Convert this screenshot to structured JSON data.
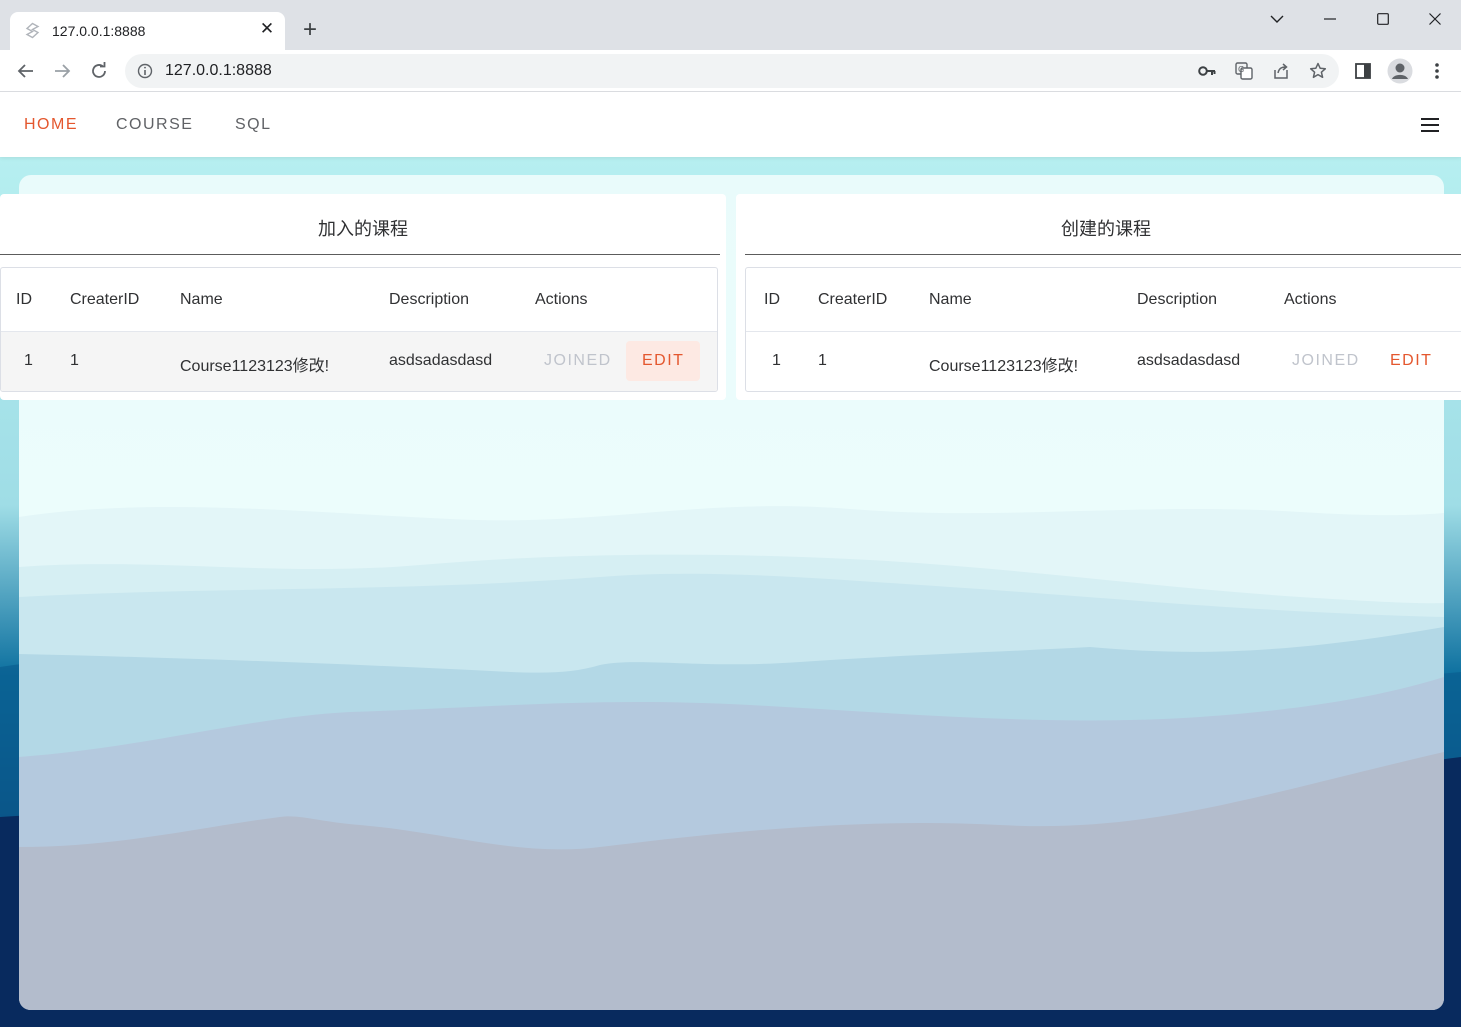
{
  "browser": {
    "tab_title": "127.0.0.1:8888",
    "url": "127.0.0.1:8888"
  },
  "nav": {
    "items": [
      {
        "label": "HOME",
        "active": true
      },
      {
        "label": "COURSE",
        "active": false
      },
      {
        "label": "SQL",
        "active": false
      }
    ]
  },
  "joined_courses": {
    "title": "加入的课程",
    "columns": [
      "ID",
      "CreaterID",
      "Name",
      "Description",
      "Actions"
    ],
    "rows": [
      {
        "id": "1",
        "creater_id": "1",
        "name": "Course1123123修改!",
        "description": "asdsadasdasd",
        "joined_label": "JOINED",
        "edit_label": "EDIT"
      }
    ]
  },
  "created_courses": {
    "title": "创建的课程",
    "columns": [
      "ID",
      "CreaterID",
      "Name",
      "Description",
      "Actions"
    ],
    "rows": [
      {
        "id": "1",
        "creater_id": "1",
        "name": "Course1123123修改!",
        "description": "asdsadasdasd",
        "joined_label": "JOINED",
        "edit_label": "EDIT"
      }
    ]
  },
  "colors": {
    "accent": "#e4572e",
    "disabled": "#c0c4cc",
    "sky": "#eafcfb"
  }
}
